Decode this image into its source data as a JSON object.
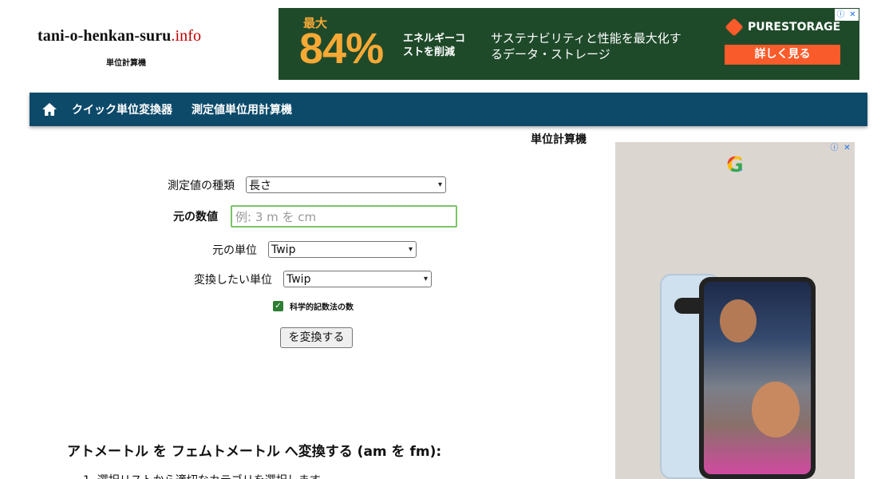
{
  "header": {
    "site_name_main": "tani-o-henkan-suru",
    "site_name_ext": ".info",
    "site_subtitle": "単位計算機"
  },
  "top_ad": {
    "max_label": "最大",
    "percent": "84%",
    "energy_text": "エネルギーコストを削減",
    "tagline": "サステナビリティと性能を最大化するデータ・ストレージ",
    "brand": "PURESTORAGE",
    "cta": "詳しく見る",
    "info_icon": "ⓘ",
    "close_icon": "✕",
    "colors": {
      "background": "#1f4a2a",
      "accent": "#f7a935",
      "cta": "#fa5b2a"
    }
  },
  "nav": {
    "home_icon": "home-icon",
    "items": [
      {
        "label": "クイック単位変換器"
      },
      {
        "label": "測定値単位用計算機"
      }
    ],
    "color": "#0d4a6a"
  },
  "form": {
    "title": "単位計算機",
    "measure_type_label": "測定値の種類",
    "measure_type_value": "長さ",
    "original_value_label": "元の数値",
    "original_value_placeholder": "例: 3 m を cm",
    "original_value": "",
    "from_unit_label": "元の単位",
    "from_unit_value": "Twip",
    "to_unit_label": "変換したい単位",
    "to_unit_value": "Twip",
    "scientific_label": "科学的記数法の数",
    "scientific_checked": true,
    "convert_button": "を変換する"
  },
  "content": {
    "heading": "アトメートル を フェムトメートル へ変換する (am を fm):",
    "step1": "1. 選択リストから適切なカテゴリを選択します"
  },
  "side_ad": {
    "brand_letter": "G",
    "info_icon": "ⓘ",
    "close_icon": "✕"
  }
}
